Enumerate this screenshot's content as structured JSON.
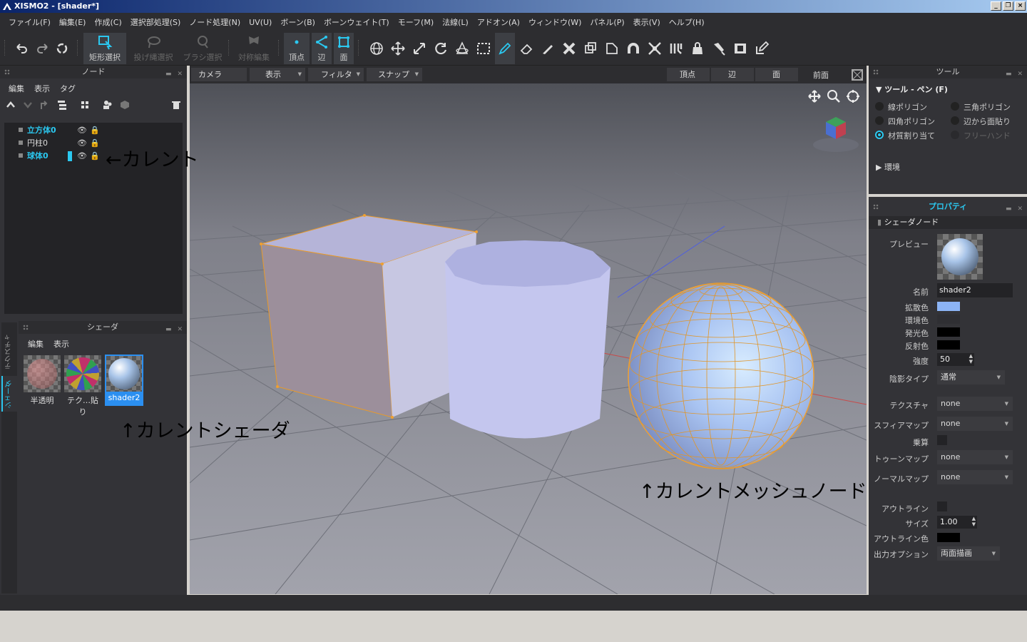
{
  "window": {
    "title": "XISMO2 - [shader*]"
  },
  "menu": [
    "ファイル(F)",
    "編集(E)",
    "作成(C)",
    "選択部処理(S)",
    "ノード処理(N)",
    "UV(U)",
    "ボーン(B)",
    "ボーンウェイト(T)",
    "モーフ(M)",
    "法線(L)",
    "アドオン(A)",
    "ウィンドウ(W)",
    "パネル(P)",
    "表示(V)",
    "ヘルプ(H)"
  ],
  "toolbar": {
    "rect_select": "矩形選択",
    "lasso_select": "投げ縄選択",
    "brush_select": "ブラシ選択",
    "symmetry_edit": "対称編集",
    "vertex": "頂点",
    "edge": "辺",
    "face": "面"
  },
  "node_panel": {
    "title": "ノード",
    "menu": [
      "編集",
      "表示",
      "タグ"
    ],
    "items": [
      {
        "label": "立方体0",
        "current": false,
        "highlight": true
      },
      {
        "label": "円柱0",
        "current": false,
        "highlight": false
      },
      {
        "label": "球体0",
        "current": true,
        "highlight": true
      }
    ]
  },
  "shader_panel": {
    "title": "シェーダ",
    "menu": [
      "編集",
      "表示"
    ],
    "side_tabs": [
      "テクスチャ",
      "シェーダ"
    ],
    "items": [
      {
        "label": "半透明",
        "selected": false
      },
      {
        "label": "テク…貼り",
        "selected": false
      },
      {
        "label": "shader2",
        "selected": true
      }
    ]
  },
  "viewport_bar": {
    "camera": "カメラ",
    "display": "表示",
    "filter": "フィルタ",
    "snap": "スナップ",
    "vertex": "頂点",
    "edge": "辺",
    "face": "面",
    "view_name": "前面"
  },
  "tool_panel": {
    "title": "ツール",
    "section": "ツール - ペン (F)",
    "options": [
      {
        "label": "線ポリゴン",
        "selected": false,
        "enabled": true
      },
      {
        "label": "三角ポリゴン",
        "selected": false,
        "enabled": true
      },
      {
        "label": "四角ポリゴン",
        "selected": false,
        "enabled": true
      },
      {
        "label": "辺から面貼り",
        "selected": false,
        "enabled": true
      },
      {
        "label": "材質割り当て",
        "selected": true,
        "enabled": true
      },
      {
        "label": "フリーハンド",
        "selected": false,
        "enabled": false
      }
    ],
    "env_section": "環境"
  },
  "property_panel": {
    "title": "プロパティ",
    "section": "シェーダノード",
    "preview_label": "プレビュー",
    "name_label": "名前",
    "name_value": "shader2",
    "diffuse_label": "拡散色",
    "diffuse_color": "#8cb4f5",
    "ambient_label": "環境色",
    "ambient_color": "#2f2f33",
    "emissive_label": "発光色",
    "emissive_color": "#000000",
    "specular_label": "反射色",
    "specular_color": "#000000",
    "strength_label": "強度",
    "strength_value": "50",
    "shading_label": "陰影タイプ",
    "shading_value": "通常",
    "texture_label": "テクスチャ",
    "texture_value": "none",
    "sphere_label": "スフィアマップ",
    "sphere_value": "none",
    "multiply_label": "乗算",
    "toon_label": "トゥーンマップ",
    "toon_value": "none",
    "normal_label": "ノーマルマップ",
    "normal_value": "none",
    "outline_label": "アウトライン",
    "size_label": "サイズ",
    "size_value": "1.00",
    "outline_color_label": "アウトライン色",
    "outline_color": "#000000",
    "output_label": "出力オプション",
    "output_value": "両面描画"
  },
  "annotations": {
    "current": "←カレント",
    "current_shader": "↑カレントシェーダ",
    "current_mesh": "↑カレントメッシュノード"
  },
  "colors": {
    "accent": "#2bc8f0",
    "panel": "#333337",
    "selection_orange": "#f0a030"
  }
}
